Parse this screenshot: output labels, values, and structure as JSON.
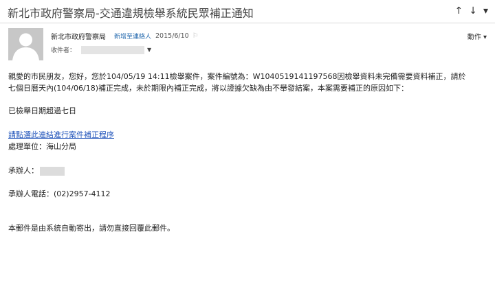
{
  "subject": "新北市政府警察局-交通違規檢舉系統民眾補正通知",
  "nav": {
    "up": "↑",
    "down": "↓",
    "more": "▾"
  },
  "sender": {
    "name": "新北市政府警察局",
    "add_contact": "新增至連絡人",
    "date": "2015/6/10",
    "to_label": "收件者："
  },
  "actions_label": "動作 ▾",
  "body": {
    "line1": "親愛的市民朋友，您好，您於104/05/19 14:11檢舉案件，案件編號為：W1040519141197568因檢舉資料未完備需要資料補正，請於",
    "line2": "七個日曆天內(104/06/18)補正完成，未於期限內補正完成，將以證據欠缺為由不舉發結案，本案需要補正的原因如下：",
    "reason": "已檢舉日期超過七日",
    "link": "請點選此連結進行案件補正程序",
    "unit": "處理單位：海山分局",
    "handler_label": "承辦人：",
    "phone": "承辦人電話：(02)2957-4112",
    "footer": "本郵件是由系統自動寄出，請勿直接回覆此郵件。"
  },
  "icons": {
    "avatar": "person-silhouette-icon",
    "flag": "flag-icon",
    "expand": "chevron-down-icon"
  }
}
